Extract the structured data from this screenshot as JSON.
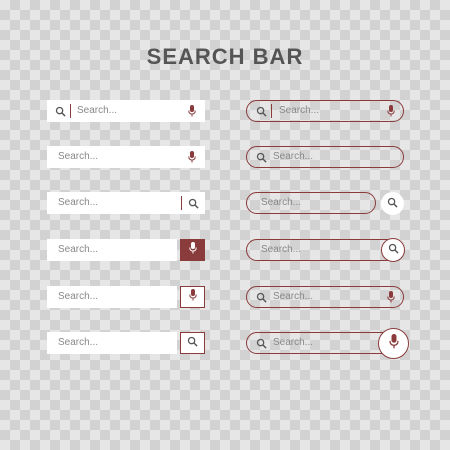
{
  "title": "SEARCH BAR",
  "placeholder": "Search...",
  "colors": {
    "accent": "#8a3b3b",
    "text": "#555555",
    "placeholder": "#888888"
  },
  "left_variants": [
    {
      "id": 1,
      "icons": [
        "search-icon",
        "mic-icon"
      ]
    },
    {
      "id": 2,
      "icons": [
        "mic-icon"
      ]
    },
    {
      "id": 3,
      "icons": [
        "search-icon"
      ]
    },
    {
      "id": 4,
      "icons": [
        "mic-icon"
      ]
    },
    {
      "id": 5,
      "icons": [
        "mic-icon"
      ]
    },
    {
      "id": 6,
      "icons": [
        "search-icon"
      ]
    }
  ],
  "right_variants": [
    {
      "id": 1,
      "icons": [
        "search-icon",
        "mic-icon"
      ]
    },
    {
      "id": 2,
      "icons": [
        "search-icon"
      ]
    },
    {
      "id": 3,
      "icons": [
        "search-icon"
      ]
    },
    {
      "id": 4,
      "icons": [
        "search-icon"
      ]
    },
    {
      "id": 5,
      "icons": [
        "search-icon",
        "mic-icon"
      ]
    },
    {
      "id": 6,
      "icons": [
        "search-icon",
        "mic-icon"
      ]
    }
  ]
}
